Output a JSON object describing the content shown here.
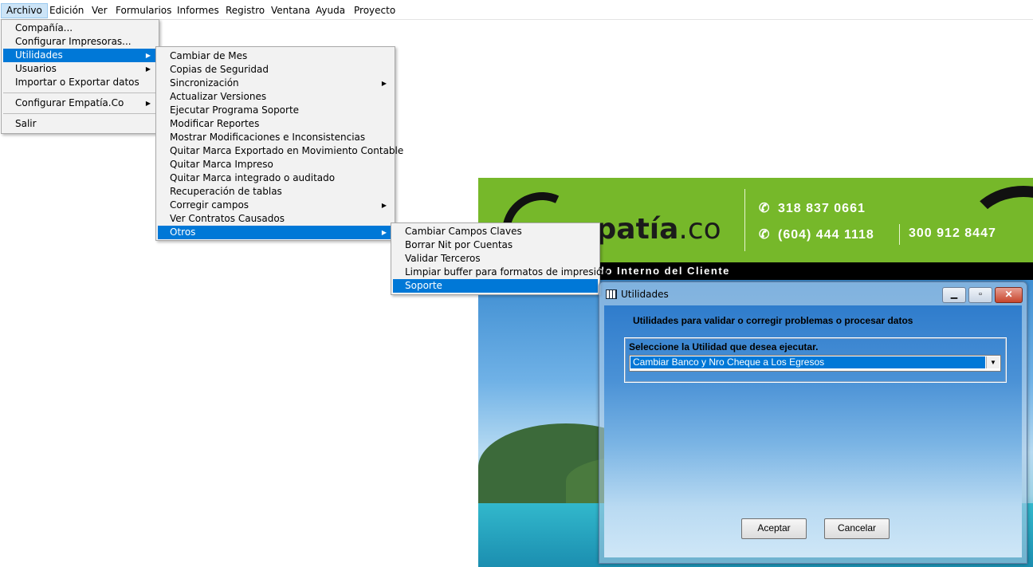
{
  "menubar": {
    "items": [
      {
        "label": "Archivo"
      },
      {
        "label": "Edición"
      },
      {
        "label": "Ver"
      },
      {
        "label": "Formularios"
      },
      {
        "label": "Informes"
      },
      {
        "label": "Registro"
      },
      {
        "label": "Ventana"
      },
      {
        "label": "Ayuda"
      },
      {
        "label": "Proyecto"
      }
    ]
  },
  "archivo_menu": {
    "items": [
      {
        "label": "Compañía..."
      },
      {
        "label": "Configurar Impresoras..."
      },
      {
        "label": "Utilidades"
      },
      {
        "label": "Usuarios"
      },
      {
        "label": "Importar o Exportar datos"
      },
      {
        "label": "Configurar Empatía.Co"
      },
      {
        "label": "Salir"
      }
    ]
  },
  "utilidades_menu": {
    "items": [
      {
        "label": "Cambiar de Mes"
      },
      {
        "label": "Copias de Seguridad"
      },
      {
        "label": "Sincronización"
      },
      {
        "label": "Actualizar Versiones"
      },
      {
        "label": "Ejecutar Programa Soporte"
      },
      {
        "label": "Modificar Reportes"
      },
      {
        "label": "Mostrar Modificaciones e Inconsistencias"
      },
      {
        "label": "Quitar Marca Exportado en Movimiento Contable"
      },
      {
        "label": "Quitar Marca Impreso"
      },
      {
        "label": "Quitar Marca integrado o auditado"
      },
      {
        "label": "Recuperación de tablas"
      },
      {
        "label": "Corregir campos"
      },
      {
        "label": "Ver Contratos Causados"
      },
      {
        "label": "Otros"
      }
    ]
  },
  "otros_menu": {
    "items": [
      {
        "label": "Cambiar Campos Claves"
      },
      {
        "label": "Borrar Nit por Cuentas"
      },
      {
        "label": "Validar Terceros"
      },
      {
        "label": "Limpiar buffer para formatos de impresión"
      },
      {
        "label": "Soporte"
      }
    ]
  },
  "banner": {
    "logo_main": "mpatía",
    "logo_suffix": ".co",
    "phone1": "318 837 0661",
    "phone2": "(604) 444 1118",
    "phone3": "300 912 8447",
    "strip_text": "do Interno del Cliente"
  },
  "dialog": {
    "title": "Utilidades",
    "heading": "Utilidades para validar o corregir problemas o procesar datos",
    "select_label": "Seleccione la Utilidad que desea ejecutar.",
    "selected_value": "Cambiar Banco y Nro Cheque a Los Egresos",
    "accept_label": "Aceptar",
    "cancel_label": "Cancelar"
  },
  "colors": {
    "selection": "#0078d7",
    "banner_green": "#76b82a"
  }
}
